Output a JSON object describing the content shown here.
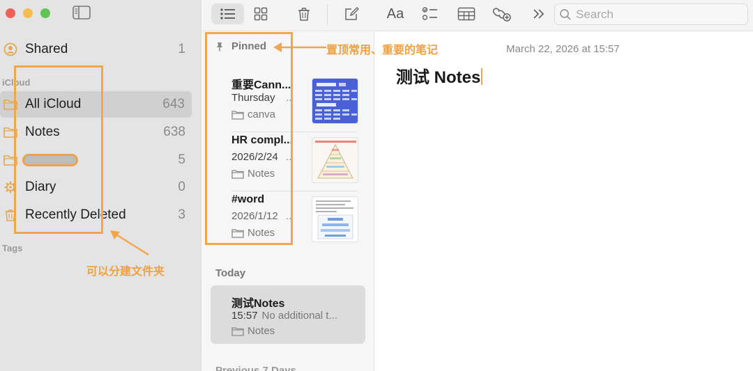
{
  "sidebar": {
    "items": [
      {
        "label": "Shared",
        "count": "1"
      },
      {
        "label": "All iCloud",
        "count": "643"
      },
      {
        "label": "Notes",
        "count": "638"
      },
      {
        "label": "",
        "count": "5"
      },
      {
        "label": "Diary",
        "count": "0"
      },
      {
        "label": "Recently Deleted",
        "count": "3"
      }
    ],
    "sections": {
      "icloud": "iCloud",
      "tags": "Tags"
    }
  },
  "toolbar": {
    "format_label": "Aa",
    "search_placeholder": "Search"
  },
  "notelist": {
    "pinned_header": "Pinned",
    "pinned": [
      {
        "title": "重要Cann...",
        "date": "Thursday",
        "ellipsis": "..",
        "folder": "canva"
      },
      {
        "title": "HR compl...",
        "date": "2026/2/24",
        "ellipsis": "..",
        "folder": "Notes"
      },
      {
        "title": "#word",
        "date": "2026/1/12",
        "ellipsis": "..",
        "folder": "Notes"
      }
    ],
    "today_header": "Today",
    "today": [
      {
        "title": "测试Notes",
        "time": "15:57",
        "preview": "No additional t...",
        "folder": "Notes"
      }
    ],
    "prev_header": "Previous 7 Days"
  },
  "editor": {
    "date": "March 22, 2026 at 15:57",
    "title": "测试 Notes"
  },
  "annotations": {
    "pinned_note": "置顶常用、重要的笔记",
    "folders_note": "可以分建文件夹"
  },
  "colors": {
    "accent": "#e3a84f",
    "annotation": "#f2a54a",
    "selected": "#d0d0d0"
  }
}
